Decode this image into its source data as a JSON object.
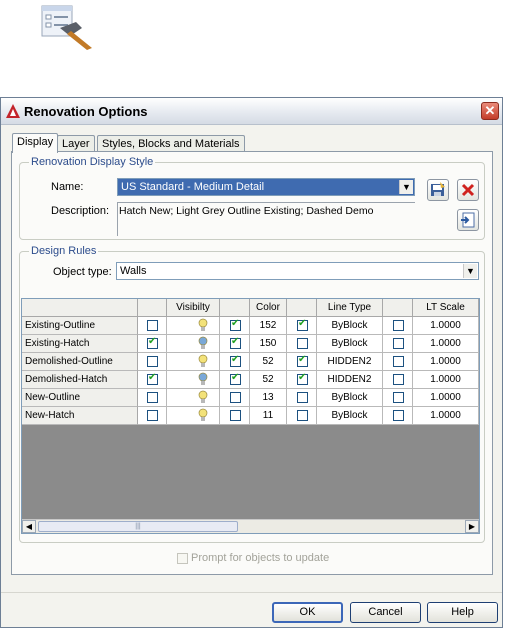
{
  "dialog": {
    "title": "Renovation Options",
    "close_label": "✕"
  },
  "tabs": [
    {
      "label": "Display",
      "active": true
    },
    {
      "label": "Layer",
      "active": false
    },
    {
      "label": "Styles, Blocks and Materials",
      "active": false
    }
  ],
  "display_style": {
    "group_title": "Renovation Display Style",
    "name_label": "Name:",
    "name_value": "US Standard - Medium Detail",
    "description_label": "Description:",
    "description_value": "Hatch New; Light Grey Outline Existing; Dashed Demo"
  },
  "design_rules": {
    "group_title": "Design Rules",
    "object_type_label": "Object type:",
    "object_type_value": "Walls"
  },
  "grid": {
    "headers": [
      "",
      "",
      "Visibilty",
      "",
      "Color",
      "",
      "Line Type",
      "",
      "LT Scale"
    ],
    "rows": [
      {
        "name": "Existing-Outline",
        "vis_check": false,
        "bulb": "yellow",
        "color_check": true,
        "color": "152",
        "lt_check": true,
        "linetype": "ByBlock",
        "lts_check": false,
        "lt_scale": "1.0000"
      },
      {
        "name": "Existing-Hatch",
        "vis_check": true,
        "bulb": "blue",
        "color_check": true,
        "color": "150",
        "lt_check": false,
        "linetype": "ByBlock",
        "lts_check": false,
        "lt_scale": "1.0000"
      },
      {
        "name": "Demolished-Outline",
        "vis_check": false,
        "bulb": "yellow",
        "color_check": true,
        "color": "52",
        "lt_check": true,
        "linetype": "HIDDEN2",
        "lts_check": false,
        "lt_scale": "1.0000"
      },
      {
        "name": "Demolished-Hatch",
        "vis_check": true,
        "bulb": "blue",
        "color_check": true,
        "color": "52",
        "lt_check": true,
        "linetype": "HIDDEN2",
        "lts_check": false,
        "lt_scale": "1.0000"
      },
      {
        "name": "New-Outline",
        "vis_check": false,
        "bulb": "yellow",
        "color_check": false,
        "color": "13",
        "lt_check": false,
        "linetype": "ByBlock",
        "lts_check": false,
        "lt_scale": "1.0000"
      },
      {
        "name": "New-Hatch",
        "vis_check": false,
        "bulb": "yellow",
        "color_check": false,
        "color": "11",
        "lt_check": false,
        "linetype": "ByBlock",
        "lts_check": false,
        "lt_scale": "1.0000"
      }
    ]
  },
  "prompt": {
    "label": "Prompt for objects to update",
    "checked": false,
    "enabled": false
  },
  "buttons": {
    "ok": "OK",
    "cancel": "Cancel",
    "help": "Help"
  },
  "icons": {
    "tool": "renovation-options-tool-icon",
    "save_style": "save-style-icon",
    "delete_style": "delete-style-icon",
    "import_style": "import-style-icon"
  },
  "colors": {
    "selection": "#3f6bb0",
    "group_title": "#2c4c8c",
    "check": "#21a121",
    "bulb_on": "#f3e27a",
    "bulb_blue": "#7aa8d8"
  }
}
